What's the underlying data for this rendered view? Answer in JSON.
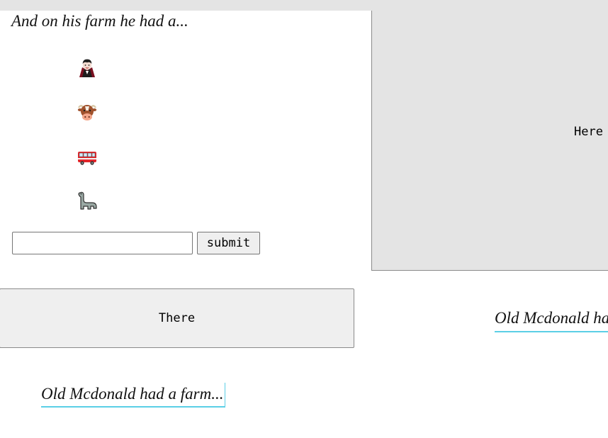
{
  "farm": {
    "heading": "And on his farm he had a...",
    "items": [
      {
        "emoji": "🧛",
        "icon": "vampire-icon"
      },
      {
        "emoji": "🐮",
        "icon": "cow-icon"
      },
      {
        "emoji": "🚒",
        "icon": "fire-engine-icon"
      },
      {
        "emoji": "🦕",
        "icon": "dinosaur-icon"
      }
    ],
    "input": {
      "value": "",
      "placeholder": ""
    },
    "submit_label": "submit"
  },
  "boxes": {
    "here_label": "Here",
    "there_label": "There"
  },
  "links": {
    "right_text": "Old Mcdonald had a farm...",
    "bottom_text": "Old Mcdonald had a farm..."
  },
  "colors": {
    "panel_gray": "#e4e4e4",
    "button_gray": "#efefef",
    "link_underline": "#5bcfe6"
  }
}
